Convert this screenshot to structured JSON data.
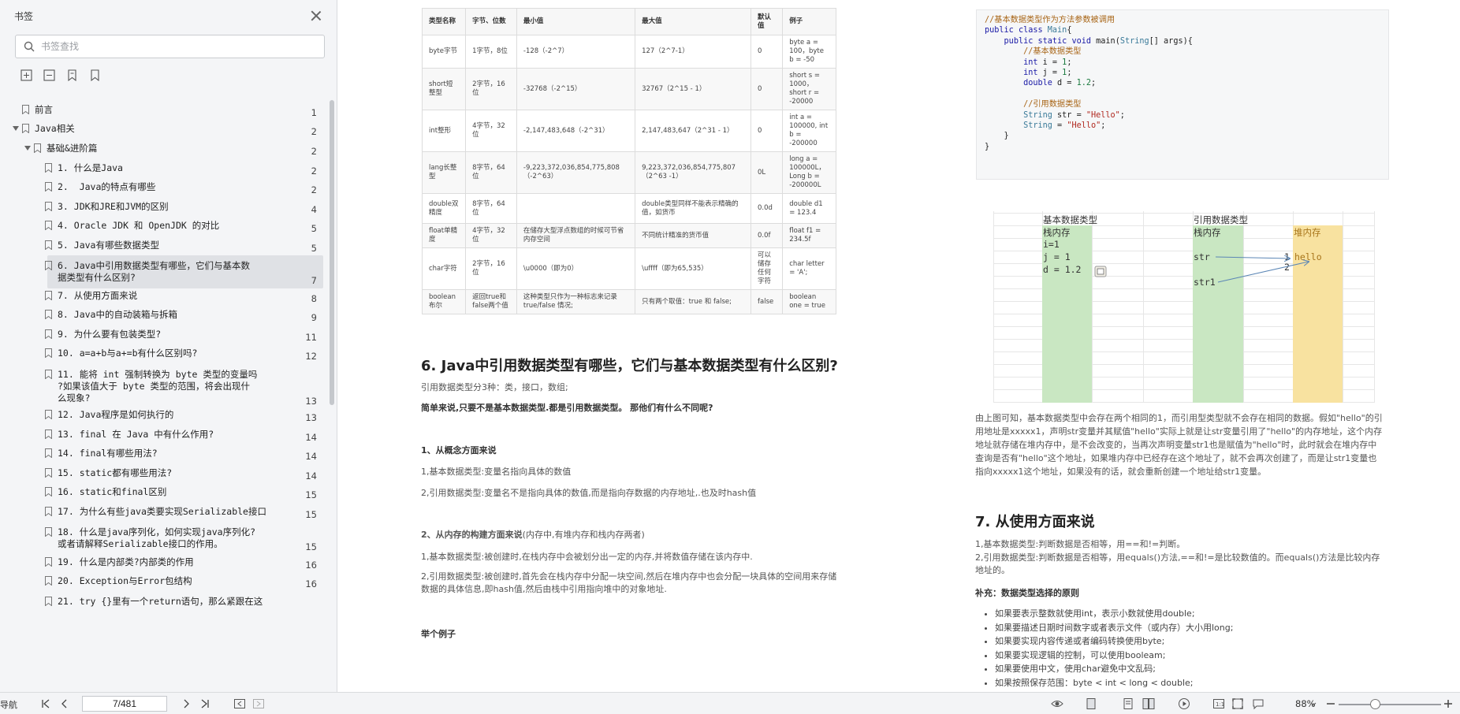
{
  "sidebar": {
    "title": "书签",
    "search_placeholder": "书签查找",
    "tools": [
      "expand-all-icon",
      "collapse-all-icon",
      "bookmark-add-icon",
      "bookmark-icon"
    ],
    "items": [
      {
        "label": "前言",
        "page": "1"
      },
      {
        "label": "Java相关",
        "page": "2"
      },
      {
        "label": "基础&进阶篇",
        "page": "2"
      },
      {
        "label": "1. 什么是Java",
        "page": "2"
      },
      {
        "label": "2.  Java的特点有哪些",
        "page": "2"
      },
      {
        "label": "3. JDK和JRE和JVM的区别",
        "page": "4"
      },
      {
        "label": "4. Oracle JDK 和 OpenJDK 的对比",
        "page": "5"
      },
      {
        "label": "5. Java有哪些数据类型",
        "page": "5"
      },
      {
        "label": "6. Java中引用数据类型有哪些，它们与基本数\n据类型有什么区别?",
        "page": "7"
      },
      {
        "label": "7. 从使用方面来说",
        "page": "8"
      },
      {
        "label": "8. Java中的自动装箱与拆箱",
        "page": "9"
      },
      {
        "label": "9. 为什么要有包装类型?",
        "page": "11"
      },
      {
        "label": "10. a=a+b与a+=b有什么区别吗?",
        "page": "12"
      },
      {
        "label": "11. 能将 int 强制转换为 byte 类型的变量吗\n?如果该值大于 byte 类型的范围，将会出现什\n么现象?",
        "page": "13"
      },
      {
        "label": "12. Java程序是如何执行的",
        "page": "13"
      },
      {
        "label": "13. final 在 Java 中有什么作用?",
        "page": "14"
      },
      {
        "label": "14. final有哪些用法?",
        "page": "14"
      },
      {
        "label": "15. static都有哪些用法?",
        "page": "14"
      },
      {
        "label": "16. static和final区别",
        "page": "15"
      },
      {
        "label": "17. 为什么有些java类要实现Serializable接口",
        "page": "15"
      },
      {
        "label": "18. 什么是java序列化，如何实现java序列化?\n或者请解释Serializable接口的作用。",
        "page": "15"
      },
      {
        "label": "19. 什么是内部类?内部类的作用",
        "page": "16"
      },
      {
        "label": "20. Exception与Error包结构",
        "page": "16"
      },
      {
        "label": "21. try {}里有一个return语句，那么紧跟在这",
        "page": ""
      }
    ]
  },
  "table": {
    "headers": [
      "类型名称",
      "字节、位数",
      "最小值",
      "最大值",
      "默认值",
      "例子"
    ],
    "rows": [
      [
        "byte字节",
        "1字节，8位",
        "-128（-2^7）",
        "127（2^7-1）",
        "0",
        "byte a = 100，byte b = -50"
      ],
      [
        "short短整型",
        "2字节，16位",
        "-32768（-2^15）",
        "32767（2^15 - 1）",
        "0",
        "short s = 1000，short r = -20000"
      ],
      [
        "int整形",
        "4字节，32位",
        "-2,147,483,648（-2^31）",
        "2,147,483,647（2^31 - 1）",
        "0",
        "int a = 100000, int b = -200000"
      ],
      [
        "lang长整型",
        "8字节，64位",
        "-9,223,372,036,854,775,808（-2^63）",
        "9,223,372,036,854,775,807（2^63 -1）",
        "0L",
        "long a = 100000L，Long b = -200000L"
      ],
      [
        "double双精度",
        "8字节，64位",
        "",
        "double类型同样不能表示精确的值，如货币",
        "0.0d",
        "double d1 = 123.4"
      ],
      [
        "float单精度",
        "4字节，32位",
        "在储存大型浮点数组的时候可节省内存空间",
        "不同统计精准的货币值",
        "0.0f",
        "float f1 = 234.5f"
      ],
      [
        "char字符",
        "2字节，16位",
        "\\u0000（即为0）",
        "\\uffff（即为65,535）",
        "可以储存任何字符",
        "char letter = 'A';"
      ],
      [
        "boolean布尔",
        "返回true和false两个值",
        "这种类型只作为一种标志来记录 true/false 情况;",
        "只有两个取值：true 和 false;",
        "false",
        "boolean one = true"
      ]
    ]
  },
  "left_content": {
    "heading": "6. Java中引用数据类型有哪些，它们与基本数据类型有什么区别?",
    "intro": "引用数据类型分3种：类，接口，数组;",
    "summary": "简单来说,只要不是基本数据类型.都是引用数据类型。 那他们有什么不同呢?",
    "sec1_title": "1、从概念方面来说",
    "sec1_p1": "1,基本数据类型:变量名指向具体的数值",
    "sec1_p2": "2,引用数据类型:变量名不是指向具体的数值,而是指向存数据的内存地址,.也及时hash值",
    "sec2_title": "2、从内存的构建方面来说",
    "sec2_title_suffix": "(内存中,有堆内存和栈内存两者)",
    "sec2_p1": "1,基本数据类型:被创建时,在栈内存中会被划分出一定的内存,并将数值存储在该内存中.",
    "sec2_p2": "2,引用数据类型:被创建时,首先会在栈内存中分配一块空间,然后在堆内存中也会分配一块具体的空间用来存储数据的具体信息,即hash值,然后由栈中引用指向堆中的对象地址.",
    "sec3_title": "举个例子"
  },
  "code": {
    "lines": [
      "//基本数据类型作为方法参数被调用",
      "public class Main{",
      "    public static void main(String[] args){",
      "        //基本数据类型",
      "        int i = 1;",
      "        int j = 1;",
      "        double d = 1.2;",
      "",
      "        //引用数据类型",
      "        String str = \"Hello\";",
      "        String str1= \"Hello\";",
      "    }",
      "}"
    ]
  },
  "diagram": {
    "label_basic": "基本数据类型",
    "label_ref": "引用数据类型",
    "stack1": "栈内存",
    "stack2": "栈内存",
    "heap": "堆内存",
    "basic_vals": [
      "i=1",
      "j = 1",
      "d = 1.2"
    ],
    "ref_vars": [
      "str",
      "str1"
    ],
    "heap_val": "hello",
    "arrow_nums": [
      "1",
      "2"
    ],
    "colors": {
      "stack": "#c9e7c2",
      "heap": "#f8e2a0",
      "arrow": "#5b86b5"
    }
  },
  "right_content": {
    "explain": "由上图可知，基本数据类型中会存在两个相同的1，而引用型类型就不会存在相同的数据。假如\"hello\"的引用地址是xxxxx1，声明str变量并其赋值\"hello\"实际上就是让str变量引用了\"hello\"的内存地址，这个内存地址就存储在堆内存中，是不会改变的，当再次声明变量str1也是赋值为\"hello\"时，此时就会在堆内存中查询是否有\"hello\"这个地址，如果堆内存中已经存在这个地址了，就不会再次创建了，而是让str1变量也指向xxxxx1这个地址，如果没有的话，就会重新创建一个地址给str1变量。",
    "heading": "7. 从使用方面来说",
    "p1": "1,基本数据类型:判断数据是否相等，用==和!=判断。",
    "p2": "2,引用数据类型:判断数据是否相等，用equals()方法,==和!=是比较数值的。而equals()方法是比较内存地址的。",
    "supplement": "补充：数据类型选择的原则",
    "bullets": [
      "如果要表示整数就使用int，表示小数就使用double;",
      "如果要描述日期时间数字或者表示文件（或内存）大小用long;",
      "如果要实现内容传递或者编码转换使用byte;",
      "如果要实现逻辑的控制，可以使用booleam;",
      "如果要使用中文，使用char避免中文乱码;",
      "如果按照保存范围：byte < int < long < double;"
    ]
  },
  "statusbar": {
    "nav_label": "导航",
    "page_display": "7/481",
    "zoom": "88%",
    "zoom_level": 0.35
  }
}
